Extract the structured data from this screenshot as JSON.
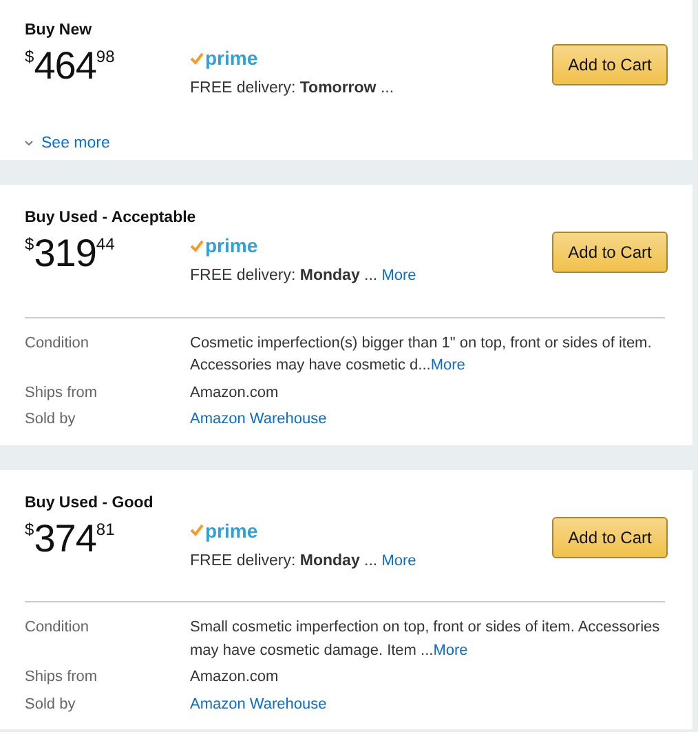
{
  "offers": [
    {
      "title": "Buy New",
      "price": {
        "currency": "$",
        "whole": "464",
        "fraction": "98"
      },
      "prime": "prime",
      "delivery": "FREE delivery: **Tomorrow** ...",
      "button": "Add to Cart",
      "see_more": "See more"
    },
    {
      "title": "Buy Used - Acceptable",
      "price": {
        "currency": "$",
        "whole": "319",
        "fraction": "44"
      },
      "prime": "prime",
      "delivery": "FREE delivery: **Monday** ...",
      "delivery_more": "More",
      "button": "Add to Cart",
      "details": [
        {
          "label": "Condition",
          "value": "Cosmetic imperfection(s) bigger than 1\" on top, front or sides of item. Accessories may have cosmetic d...",
          "more": "More",
          "kind": "text"
        },
        {
          "label": "Ships from",
          "value": "Amazon.com",
          "kind": "text"
        },
        {
          "label": "Sold by",
          "value": "Amazon Warehouse",
          "kind": "link"
        }
      ]
    },
    {
      "title": "Buy Used - Good",
      "price": {
        "currency": "$",
        "whole": "374",
        "fraction": "81"
      },
      "prime": "prime",
      "delivery": "FREE delivery: **Monday** ...",
      "delivery_more": "More",
      "button": "Add to Cart",
      "details": [
        {
          "label": "Condition",
          "value": "Small cosmetic imperfection on top, front or sides of item. Accessories may have cosmetic damage. Item ...",
          "more": "More",
          "kind": "text"
        },
        {
          "label": "Ships from",
          "value": "Amazon.com",
          "kind": "text"
        },
        {
          "label": "Sold by",
          "value": "Amazon Warehouse",
          "kind": "link"
        }
      ]
    }
  ]
}
